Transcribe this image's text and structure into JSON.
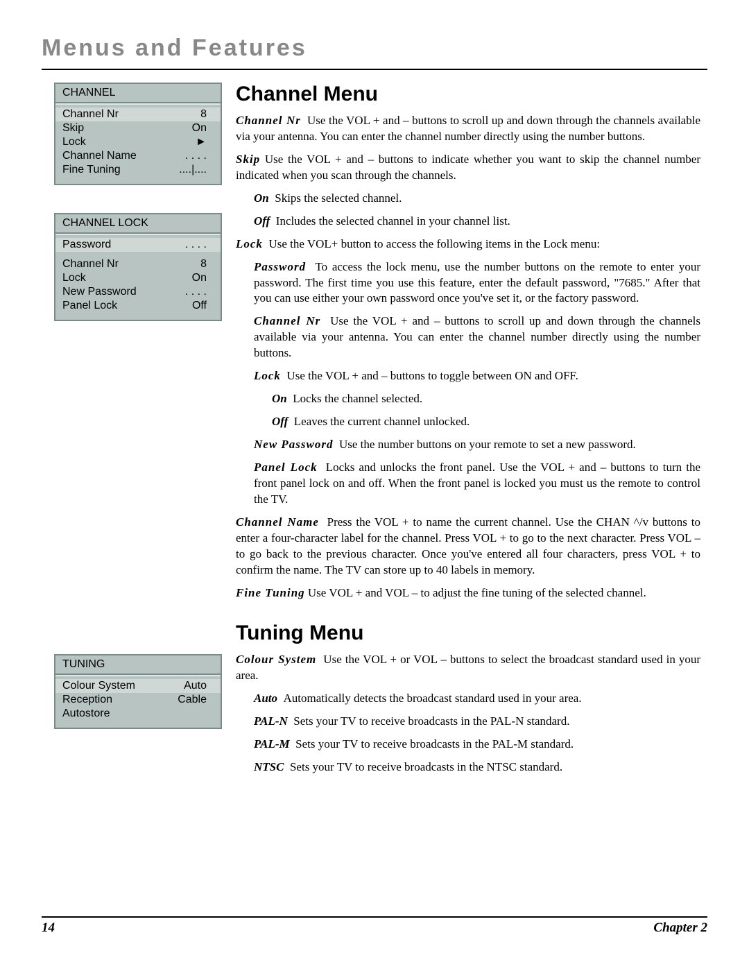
{
  "header": "Menus and Features",
  "footer": {
    "page": "14",
    "chapter": "Chapter 2"
  },
  "menus": {
    "channel": {
      "title": "CHANNEL",
      "rows": [
        {
          "label": "Channel Nr",
          "value": "8"
        },
        {
          "label": "Skip",
          "value": "On"
        },
        {
          "label": "Lock",
          "value": "►"
        },
        {
          "label": "Channel Name",
          "value": ". . . ."
        },
        {
          "label": "Fine Tuning",
          "value": "....|...."
        }
      ]
    },
    "channel_lock": {
      "title": "CHANNEL LOCK",
      "rows": [
        {
          "label": "Password",
          "value": ". . . ."
        },
        {
          "label": "Channel Nr",
          "value": "8"
        },
        {
          "label": "Lock",
          "value": "On"
        },
        {
          "label": "New Password",
          "value": ". . . ."
        },
        {
          "label": "Panel Lock",
          "value": "Off"
        }
      ]
    },
    "tuning": {
      "title": "TUNING",
      "rows": [
        {
          "label": "Colour System",
          "value": "Auto"
        },
        {
          "label": "Reception",
          "value": "Cable"
        },
        {
          "label": "Autostore",
          "value": ""
        }
      ]
    }
  },
  "sections": {
    "channel_menu": {
      "title": "Channel Menu",
      "p1": {
        "term": "Channel Nr",
        "text": "Use the VOL + and – buttons to scroll up and down through the channels available via your antenna. You can enter the channel number directly using the number buttons."
      },
      "p2": {
        "term": "Skip",
        "text": "Use the VOL + and – buttons to indicate whether you want to skip the channel number indicated when you scan through the channels."
      },
      "p3": {
        "term": "On",
        "text": "Skips the selected channel."
      },
      "p4": {
        "term": "Off",
        "text": "Includes the selected channel in your channel list."
      },
      "p5": {
        "term": "Lock",
        "text": "Use the VOL+ button to access the following items in the Lock menu:"
      },
      "p6": {
        "term": "Password",
        "text": "To access the lock menu, use the number buttons on the remote to enter your password. The first time you use this feature, enter the default password, \"7685.\" After that you can use either your own password once you've set it, or the factory password."
      },
      "p7": {
        "term": "Channel Nr",
        "text": "Use the VOL + and – buttons to scroll up and down through the channels available via your antenna. You can enter the channel number directly using the number buttons."
      },
      "p8": {
        "term": "Lock",
        "text": "Use the VOL + and – buttons to toggle between ON and OFF."
      },
      "p9": {
        "term": "On",
        "text": "Locks the channel selected."
      },
      "p10": {
        "term": "Off",
        "text": "Leaves the current channel unlocked."
      },
      "p11": {
        "term": "New Password",
        "text": "Use the number buttons on your remote to set a new password."
      },
      "p12": {
        "term": "Panel Lock",
        "text": "Locks and unlocks the front panel. Use the VOL + and – buttons to turn the front panel lock on and off. When the front panel is locked you must us the remote to control the TV."
      },
      "p13": {
        "term": "Channel Name",
        "text": "Press the VOL + to name the current channel. Use the CHAN ^/v buttons to enter a four-character label for the channel. Press VOL + to go to the next character. Press VOL – to go back to the previous character. Once you've entered all four characters, press VOL + to confirm the name. The TV can store up to 40 labels in memory."
      },
      "p14": {
        "term": "Fine Tuning",
        "text": "Use VOL + and VOL – to adjust the fine tuning of the selected channel."
      }
    },
    "tuning_menu": {
      "title": "Tuning Menu",
      "p1": {
        "term": "Colour System",
        "text": "Use the VOL + or VOL – buttons to select the broadcast standard used in your area."
      },
      "p2": {
        "term": "Auto",
        "text": "Automatically detects the broadcast standard used in your area."
      },
      "p3": {
        "term": "PAL-N",
        "text": "Sets your TV to receive broadcasts in the PAL-N standard."
      },
      "p4": {
        "term": "PAL-M",
        "text": "Sets your TV to receive broadcasts in the PAL-M standard."
      },
      "p5": {
        "term": "NTSC",
        "text": "Sets your TV to receive broadcasts in the NTSC standard."
      }
    }
  }
}
